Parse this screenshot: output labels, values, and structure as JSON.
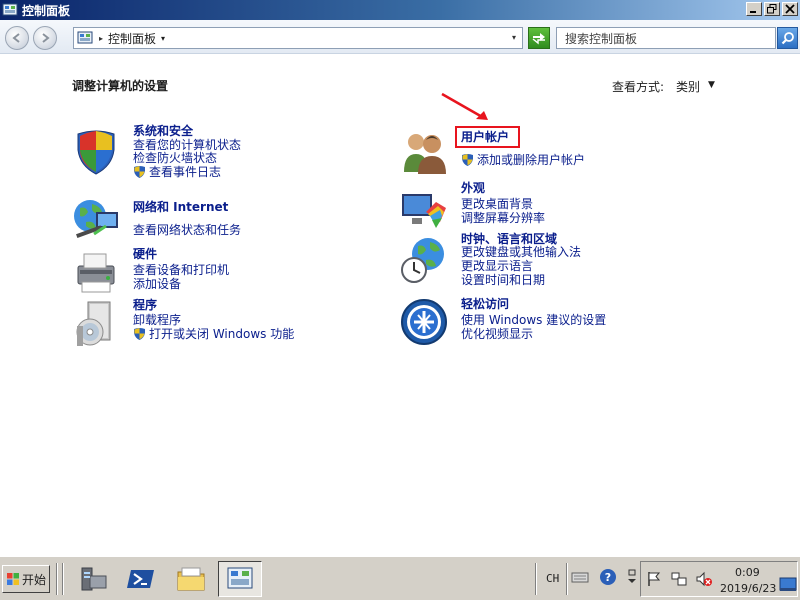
{
  "window": {
    "title": "控制面板"
  },
  "address_bar": {
    "breadcrumb": "控制面板",
    "search_placeholder": "搜索控制面板"
  },
  "content": {
    "heading": "调整计算机的设置",
    "view_by_label": "查看方式:",
    "view_by_value": "类别"
  },
  "categories_left": [
    {
      "icon": "security-shield-icon",
      "title": "系统和安全",
      "links": [
        "查看您的计算机状态",
        "检查防火墙状态",
        "查看事件日志"
      ]
    },
    {
      "icon": "network-globe-icon",
      "title": "网络和 Internet",
      "links": [
        "查看网络状态和任务"
      ]
    },
    {
      "icon": "printer-icon",
      "title": "硬件",
      "links": [
        "查看设备和打印机",
        "添加设备"
      ]
    },
    {
      "icon": "programs-disc-icon",
      "title": "程序",
      "links": [
        "卸载程序",
        "打开或关闭 Windows 功能"
      ]
    }
  ],
  "categories_right": [
    {
      "icon": "users-icon",
      "title": "用户帐户",
      "links": [
        "添加或删除用户帐户"
      ]
    },
    {
      "icon": "appearance-icon",
      "title": "外观",
      "links": [
        "更改桌面背景",
        "调整屏幕分辨率"
      ]
    },
    {
      "icon": "clock-globe-icon",
      "title": "时钟、语言和区域",
      "links": [
        "更改键盘或其他输入法",
        "更改显示语言",
        "设置时间和日期"
      ]
    },
    {
      "icon": "accessibility-icon",
      "title": "轻松访问",
      "links": [
        "使用 Windows 建议的设置",
        "优化视频显示"
      ]
    }
  ],
  "taskbar": {
    "start_label": "开始",
    "language": "CH",
    "time": "0:09",
    "date": "2019/6/23"
  },
  "colors": {
    "link": "#0a1e8c",
    "highlight_box": "#e8141e",
    "title_bar": "#0a246a"
  }
}
